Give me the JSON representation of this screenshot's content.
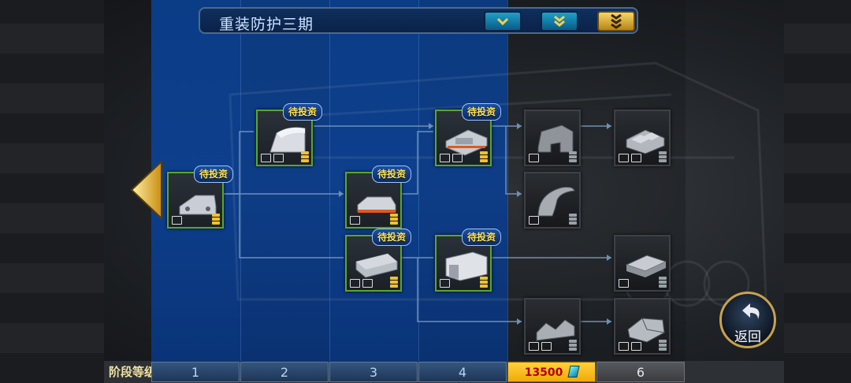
{
  "header": {
    "title": "重装防护三期",
    "buttons": [
      {
        "name": "collapse-one-button",
        "style": "blue",
        "chevrons": 1
      },
      {
        "name": "collapse-two-button",
        "style": "blue",
        "chevrons": 2
      },
      {
        "name": "collapse-three-button",
        "style": "gold",
        "chevrons": 3
      }
    ]
  },
  "colors": {
    "accent_gold": "#f2c12e",
    "node_border_active": "#5aa62c",
    "column_blue": "#0d3f8d"
  },
  "nodes": [
    {
      "id": "n1",
      "badge": "待投资",
      "part": "bracket",
      "icons": [
        "card"
      ],
      "rank": 3,
      "active": true
    },
    {
      "id": "n2",
      "badge": "待投资",
      "part": "wedge",
      "icons": [
        "card",
        "cup"
      ],
      "rank": 3,
      "active": true
    },
    {
      "id": "n3",
      "badge": "待投资",
      "part": "slab",
      "icons": [
        "stack"
      ],
      "rank": 3,
      "active": true
    },
    {
      "id": "n4",
      "badge": "待投资",
      "part": "plate",
      "icons": [
        "card",
        "slash"
      ],
      "rank": 3,
      "active": true
    },
    {
      "id": "n5",
      "badge": "待投资",
      "part": "frame",
      "icons": [
        "stack",
        "cup"
      ],
      "rank": 3,
      "active": true
    },
    {
      "id": "n6",
      "badge": "待投资",
      "part": "block",
      "icons": [
        "trap"
      ],
      "rank": 3,
      "active": true
    },
    {
      "id": "n7",
      "badge": "",
      "part": "ramp",
      "icons": [
        "cup"
      ],
      "rank": 3,
      "active": false
    },
    {
      "id": "n8",
      "badge": "",
      "part": "hook",
      "icons": [
        "bowl"
      ],
      "rank": 3,
      "active": false
    },
    {
      "id": "n9",
      "badge": "",
      "part": "twin",
      "icons": [
        "trap",
        "slash"
      ],
      "rank": 3,
      "active": false
    },
    {
      "id": "n10",
      "badge": "",
      "part": "tiles",
      "icons": [
        "stack",
        "slash"
      ],
      "rank": 3,
      "active": false
    },
    {
      "id": "n11",
      "badge": "",
      "part": "layers",
      "icons": [
        "stack"
      ],
      "rank": 3,
      "active": false
    },
    {
      "id": "n12",
      "badge": "",
      "part": "twin2",
      "icons": [
        "stack",
        "slash"
      ],
      "rank": 3,
      "active": false
    }
  ],
  "bottom": {
    "stage_label": "阶段等级",
    "tabs": [
      {
        "label": "1",
        "state": "normal"
      },
      {
        "label": "2",
        "state": "normal"
      },
      {
        "label": "3",
        "state": "normal"
      },
      {
        "label": "4",
        "state": "normal"
      },
      {
        "label": "13500",
        "state": "current"
      },
      {
        "label": "6",
        "state": "locked"
      }
    ]
  },
  "back_button": {
    "label": "返回",
    "icon": "return-arrow-icon"
  },
  "nav": {
    "left_arrow_icon": "left-arrow-icon"
  }
}
